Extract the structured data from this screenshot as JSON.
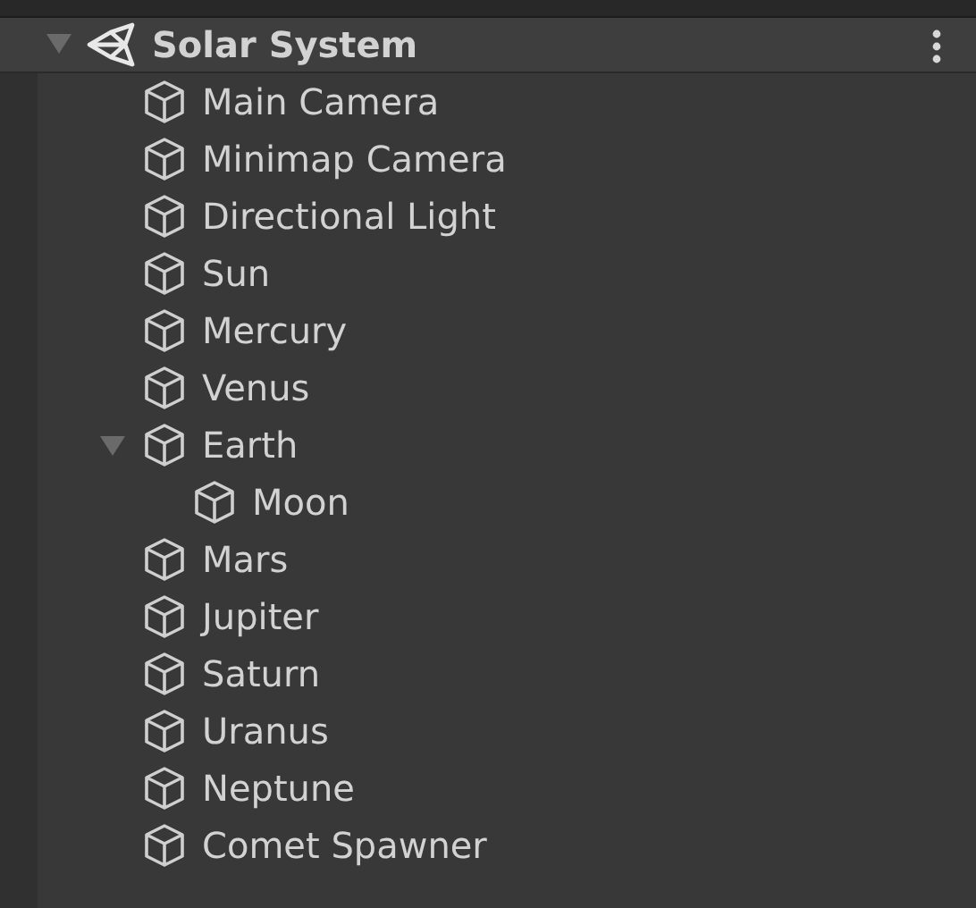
{
  "scene": {
    "title": "Solar System",
    "expanded": true
  },
  "items": [
    {
      "label": "Main Camera"
    },
    {
      "label": "Minimap Camera"
    },
    {
      "label": "Directional Light"
    },
    {
      "label": "Sun"
    },
    {
      "label": "Mercury"
    },
    {
      "label": "Venus"
    },
    {
      "label": "Earth",
      "expanded": true,
      "children": [
        {
          "label": "Moon"
        }
      ]
    },
    {
      "label": "Mars"
    },
    {
      "label": "Jupiter"
    },
    {
      "label": "Saturn"
    },
    {
      "label": "Uranus"
    },
    {
      "label": "Neptune"
    },
    {
      "label": "Comet Spawner"
    }
  ]
}
